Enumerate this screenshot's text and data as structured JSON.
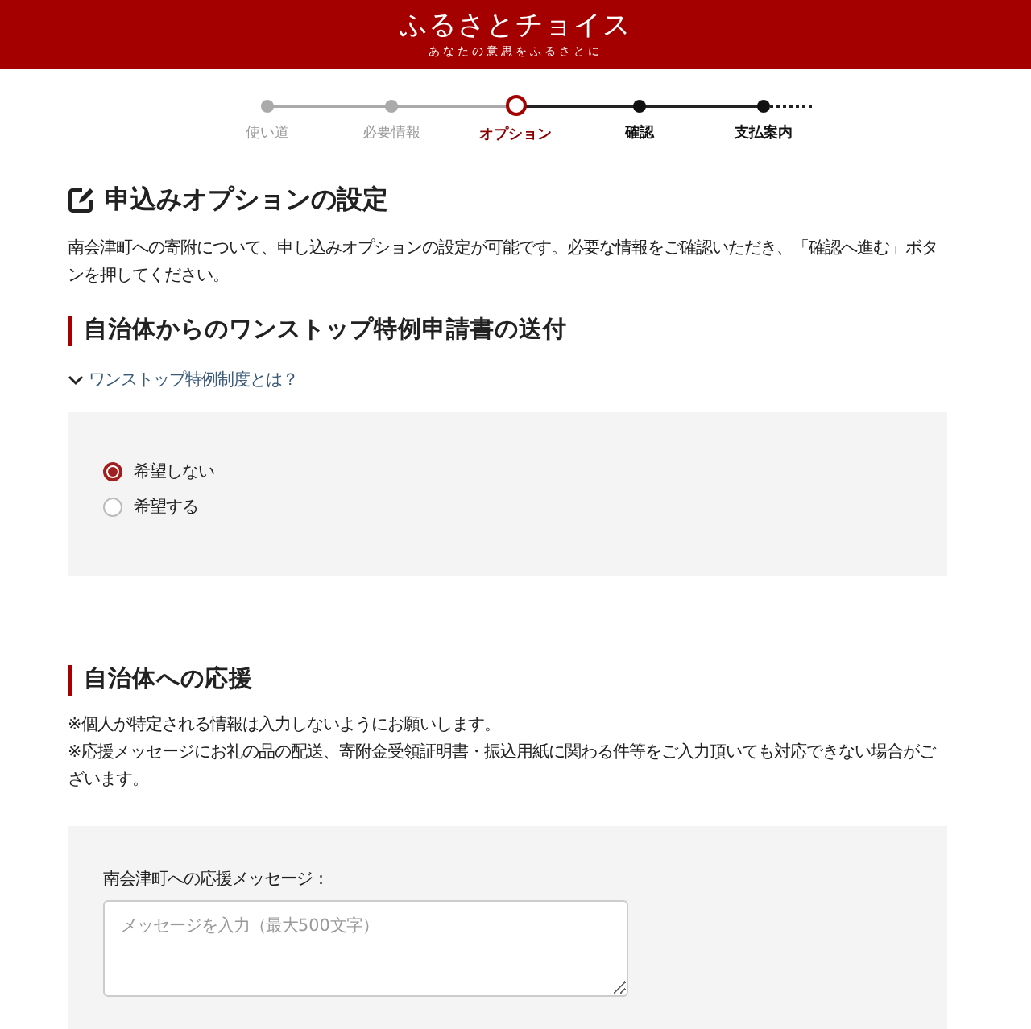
{
  "header": {
    "logo": "ふるさとチョイス",
    "tagline": "あなたの意思をふるさとに"
  },
  "steps": [
    {
      "label": "使い道",
      "completed": true,
      "selected": false
    },
    {
      "label": "必要情報",
      "completed": true,
      "selected": false
    },
    {
      "label": "オプション",
      "completed": false,
      "selected": true
    },
    {
      "label": "確認",
      "completed": false,
      "selected": false
    },
    {
      "label": "支払案内",
      "completed": false,
      "selected": false
    }
  ],
  "page_title": "申込みオプションの設定",
  "intro": "南会津町への寄附について、申し込みオプションの設定が可能です。必要な情報をご確認いただき、「確認へ進む」ボタンを押してください。",
  "sections": [
    {
      "kind": "options",
      "heading": "自治体からのワンストップ特例申請書の送付",
      "toggle": "ワンストップ特例制度とは？",
      "options": [
        {
          "label": "希望しない",
          "selected": true
        },
        {
          "label": "希望する",
          "selected": false
        }
      ]
    },
    {
      "kind": "message",
      "heading": "自治体への応援",
      "notes": [
        "※個人が特定される情報は入力しないようにお願いします。",
        "※応援メッセージにお礼の品の配送、寄附金受領証明書・振込用紙に関わる件等をご入力頂いても対応できない場合がございます。"
      ],
      "field": {
        "label": "南会津町への応援メッセージ：",
        "placeholder": "メッセージを入力（最大500文字）"
      }
    }
  ]
}
